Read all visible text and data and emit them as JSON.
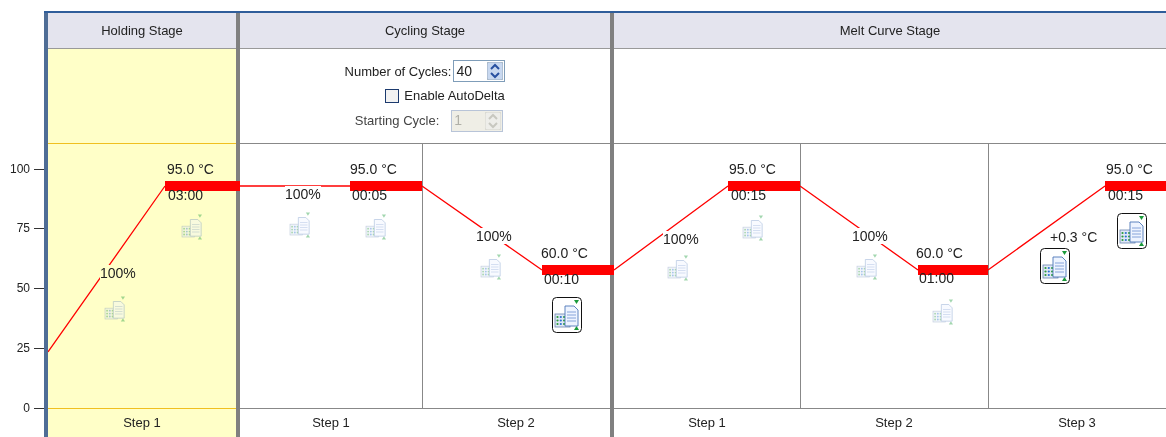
{
  "axis": {
    "ticks": [
      "100",
      "75",
      "50",
      "25",
      "0"
    ]
  },
  "stages": [
    {
      "title": "Holding Stage",
      "selected": true,
      "steps": [
        {
          "label": "Step 1",
          "temperature": "95.0 °C",
          "time": "03:00",
          "ramp": "100%",
          "ramp_collect": false,
          "hold_collect": false
        }
      ]
    },
    {
      "title": "Cycling Stage",
      "selected": false,
      "settings": {
        "cycles_label": "Number of Cycles:",
        "cycles": "40",
        "autodelta_label": "Enable AutoDelta",
        "autodelta": false,
        "starting_cycle_label": "Starting Cycle:",
        "starting_cycle": "1",
        "starting_cycle_disabled": true
      },
      "steps": [
        {
          "label": "Step 1",
          "temperature": "95.0 °C",
          "time": "00:05",
          "ramp": "100%",
          "ramp_collect": false,
          "hold_collect": false
        },
        {
          "label": "Step 2",
          "temperature": "60.0 °C",
          "time": "00:10",
          "ramp": "100%",
          "ramp_collect": false,
          "hold_collect": true
        }
      ]
    },
    {
      "title": "Melt Curve Stage",
      "selected": false,
      "steps": [
        {
          "label": "Step 1",
          "temperature": "95.0 °C",
          "time": "00:15",
          "ramp": "100%",
          "ramp_collect": false,
          "hold_collect": false
        },
        {
          "label": "Step 2",
          "temperature": "60.0 °C",
          "time": "01:00",
          "ramp": "100%",
          "ramp_collect": false,
          "hold_collect": false
        },
        {
          "label": "Step 3",
          "temperature": "95.0 °C",
          "time": "00:15",
          "ramp": "+0.3 °C",
          "ramp_collect": true,
          "hold_collect": true
        }
      ]
    }
  ]
}
